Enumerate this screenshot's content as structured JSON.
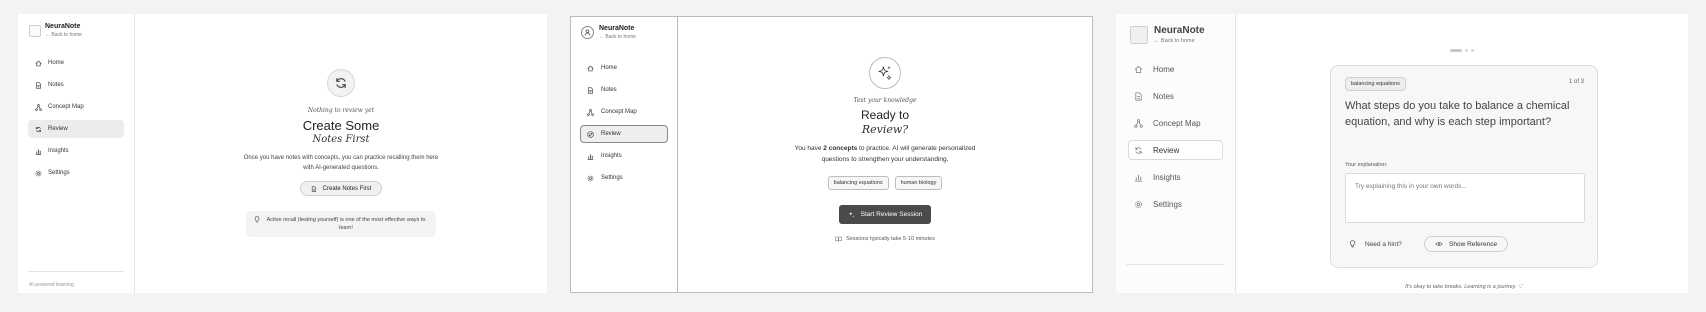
{
  "app": {
    "name": "NeuraNote",
    "back_label": "← Back to home"
  },
  "nav": [
    "Home",
    "Notes",
    "Concept Map",
    "Review",
    "Insights",
    "Settings"
  ],
  "panel1": {
    "footer": "AI-powered learning",
    "eyebrow": "Nothing to review yet",
    "title_line1": "Create Some",
    "title_line2": "Notes First",
    "body": "Once you have notes with concepts, you can practice recalling them here with AI-generated questions.",
    "button": "Create Notes First",
    "tip": "Active recall (testing yourself) is one of the most effective ways to learn!"
  },
  "panel2": {
    "eyebrow": "Test your knowledge",
    "title_line1": "Ready to",
    "title_line2": "Review?",
    "body_prefix": "You have ",
    "body_count": "2 concepts",
    "body_suffix": " to practice. AI will generate personalized questions to strengthen your understanding.",
    "tags": [
      "balancing equations",
      "human biology"
    ],
    "button": "Start Review Session",
    "note": "Sessions typically take 5-10 minutes"
  },
  "panel3": {
    "tag": "balancing equations",
    "counter": "1 of 3",
    "question": "What steps do you take to balance a chemical equation, and why is each step important?",
    "answer_label": "Your explanation:",
    "answer_placeholder": "Try explaining this in your own words...",
    "hint": "Need a hint?",
    "reference": "Show Reference",
    "footer": "It's okay to take breaks. Learning is a journey. ♡"
  }
}
